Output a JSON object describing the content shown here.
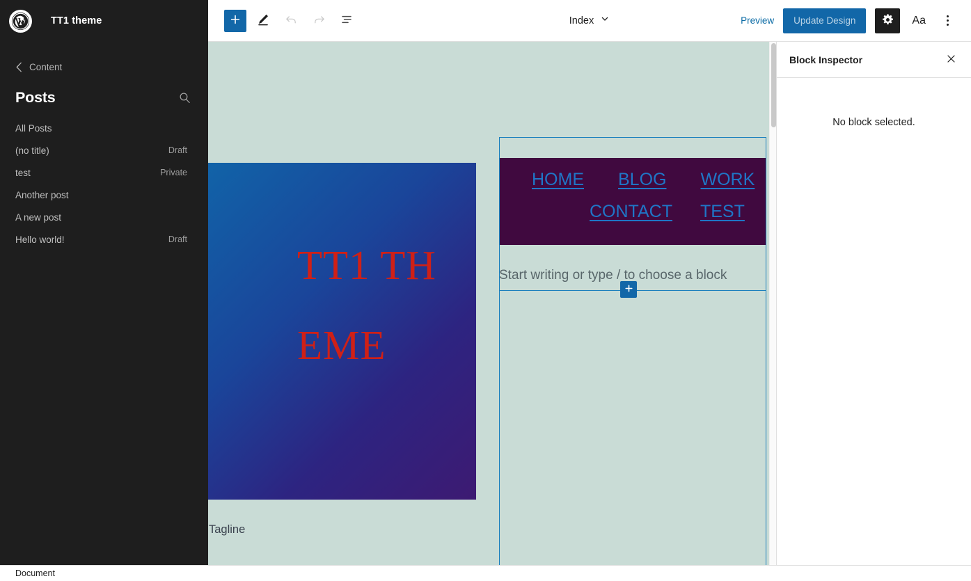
{
  "sidebar": {
    "logo_icon": "wordpress-logo-icon",
    "site_title": "TT1 theme",
    "back_label": "Content",
    "back_icon": "chevron-left-icon",
    "section_title": "Posts",
    "search_icon": "search-icon",
    "items": [
      {
        "label": "All Posts",
        "status": ""
      },
      {
        "label": "(no title)",
        "status": "Draft"
      },
      {
        "label": "test",
        "status": "Private"
      },
      {
        "label": "Another post",
        "status": ""
      },
      {
        "label": "A new post",
        "status": ""
      },
      {
        "label": "Hello world!",
        "status": "Draft"
      }
    ]
  },
  "toolbar": {
    "add_block_icon": "plus-icon",
    "edit_icon": "pencil-icon",
    "undo_icon": "undo-icon",
    "redo_icon": "redo-icon",
    "list_view_icon": "list-view-icon",
    "document_name": "Index",
    "document_chevron_icon": "chevron-down-icon",
    "preview_label": "Preview",
    "update_label": "Update Design",
    "settings_icon": "gear-icon",
    "typography_label": "Aa",
    "more_icon": "kebab-menu-icon",
    "accent_color": "#1267a8"
  },
  "canvas": {
    "background_color": "#c9dcd6",
    "hero": {
      "title": "TT1 THEME",
      "text_color": "#cf2017",
      "gradient_from": "#1163a8",
      "gradient_to": "#3d1a72"
    },
    "tagline": "Tagline",
    "navigation": {
      "background_color": "#40093f",
      "link_color": "#1f76c7",
      "row1": [
        "HOME",
        "BLOG",
        "WORK"
      ],
      "row2": [
        "CONTACT",
        "TEST"
      ]
    },
    "paragraph_placeholder": "Start writing or type / to choose a block",
    "appender_icon": "plus-icon"
  },
  "inspector": {
    "title": "Block Inspector",
    "close_icon": "close-icon",
    "empty_message": "No block selected."
  },
  "statusbar": {
    "document_label": "Document"
  }
}
